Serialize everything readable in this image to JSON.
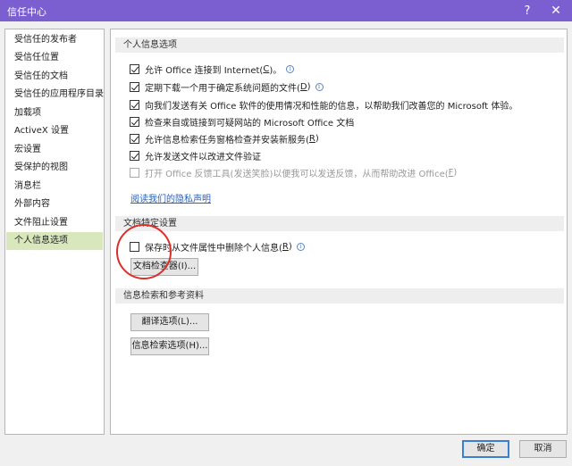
{
  "window": {
    "title": "信任中心",
    "help_glyph": "?",
    "close_glyph": "✕"
  },
  "sidebar": {
    "items": [
      {
        "label": "受信任的发布者"
      },
      {
        "label": "受信任位置"
      },
      {
        "label": "受信任的文档"
      },
      {
        "label": "受信任的应用程序目录"
      },
      {
        "label": "加载项"
      },
      {
        "label": "ActiveX 设置"
      },
      {
        "label": "宏设置"
      },
      {
        "label": "受保护的视图"
      },
      {
        "label": "消息栏"
      },
      {
        "label": "外部内容"
      },
      {
        "label": "文件阻止设置"
      },
      {
        "label": "个人信息选项"
      }
    ],
    "selected_index": 11
  },
  "personal_info": {
    "heading": "个人信息选项",
    "options": [
      {
        "text": "允许 Office 连接到 Internet(",
        "key": "C",
        "suffix": ")。",
        "checked": true,
        "info": true
      },
      {
        "text": "定期下载一个用于确定系统问题的文件(",
        "key": "D",
        "suffix": ")",
        "checked": true,
        "info": true
      },
      {
        "text": "向我们发送有关 Office 软件的使用情况和性能的信息，以帮助我们改善您的 Microsoft 体验。",
        "key": "",
        "suffix": "",
        "checked": true,
        "info": false
      },
      {
        "text": "检查来自或链接到可疑网站的 Microsoft Office 文档",
        "key": "",
        "suffix": "",
        "checked": true,
        "info": false
      },
      {
        "text": "允许信息检索任务窗格检查并安装新服务(",
        "key": "R",
        "suffix": ")",
        "checked": true,
        "info": false
      },
      {
        "text": "允许发送文件以改进文件验证",
        "key": "",
        "suffix": "",
        "checked": true,
        "info": false
      },
      {
        "text": "打开 Office 反馈工具(发送笑脸)以便我可以发送反馈，从而帮助改进 Office(",
        "key": "F",
        "suffix": ")",
        "checked": false,
        "info": false,
        "disabled": true
      }
    ],
    "privacy_link": "阅读我们的隐私声明"
  },
  "doc_specific": {
    "heading": "文档特定设置",
    "option": {
      "text": "保存时从文件属性中删除个人信息(",
      "key": "R",
      "suffix": ")",
      "checked": false
    },
    "inspector_button": "文档检查器(I)..."
  },
  "research": {
    "heading": "信息检索和参考资料",
    "translate_button": "翻译选项(L)...",
    "research_button": "信息检索选项(H)..."
  },
  "footer": {
    "ok": "确定",
    "cancel": "取消"
  }
}
